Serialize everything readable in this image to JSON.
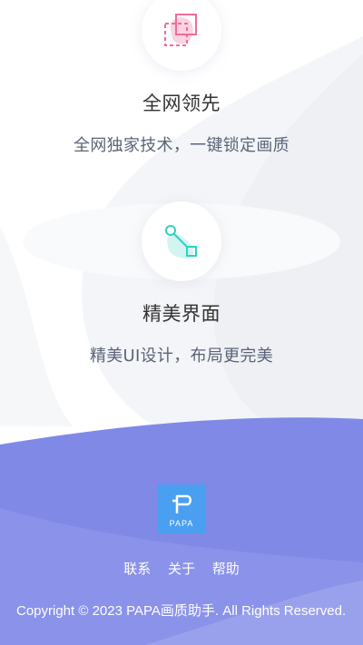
{
  "features": [
    {
      "icon": "select-region-icon",
      "title": "全网领先",
      "desc": "全网独家技术，一键锁定画质"
    },
    {
      "icon": "node-connect-icon",
      "title": "精美界面",
      "desc": "精美UI设计，布局更完美"
    }
  ],
  "footer": {
    "logo_text": "PAPA",
    "links": [
      "联系",
      "关于",
      "帮助"
    ],
    "copyright": "Copyright © 2023 PAPA画质助手. All Rights Reserved."
  },
  "colors": {
    "footer_bg": "#8189e6",
    "logo_bg": "#4a9ff0",
    "icon_pink": "#f06b9c",
    "icon_teal": "#2fd1c4"
  }
}
